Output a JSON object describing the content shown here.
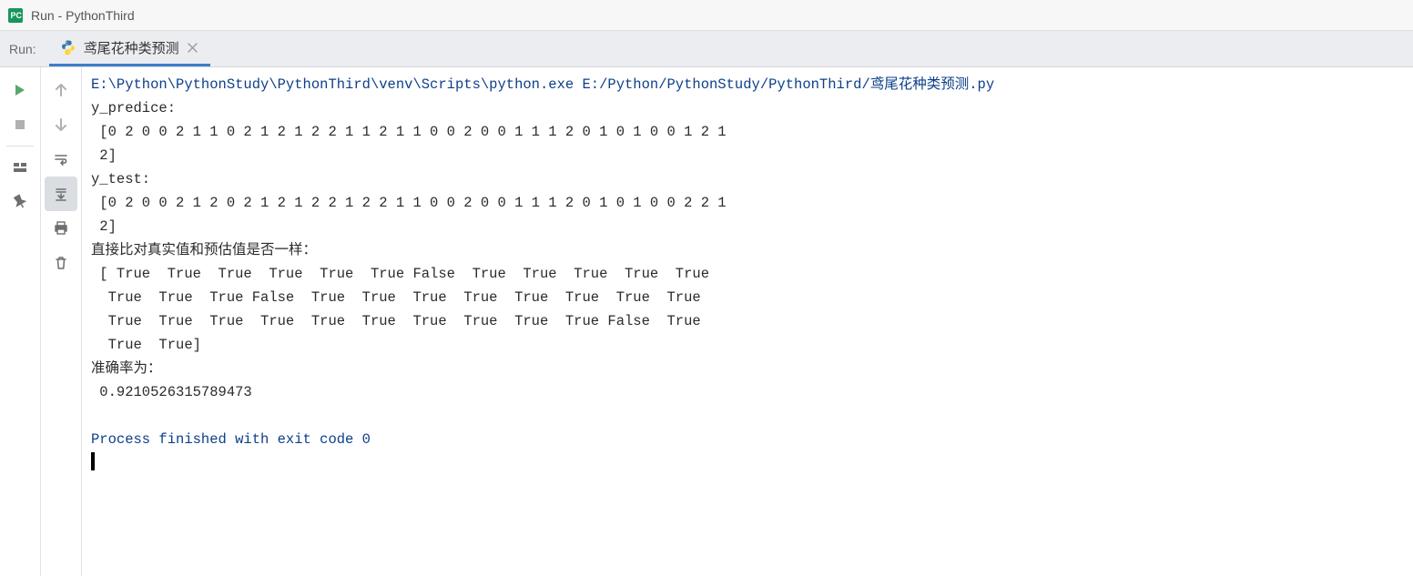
{
  "window": {
    "title": "Run - PythonThird"
  },
  "run_panel": {
    "label": "Run:",
    "tab": {
      "label": "鸢尾花种类预测"
    }
  },
  "console": {
    "command": "E:\\Python\\PythonStudy\\PythonThird\\venv\\Scripts\\python.exe E:/Python/PythonStudy/PythonThird/鸢尾花种类预测.py",
    "lines": [
      "y_predice:",
      " [0 2 0 0 2 1 1 0 2 1 2 1 2 2 1 1 2 1 1 0 0 2 0 0 1 1 1 2 0 1 0 1 0 0 1 2 1",
      " 2]",
      "y_test:",
      " [0 2 0 0 2 1 2 0 2 1 2 1 2 2 1 2 2 1 1 0 0 2 0 0 1 1 1 2 0 1 0 1 0 0 2 2 1",
      " 2]",
      "直接比对真实值和预估值是否一样：",
      " [ True  True  True  True  True  True False  True  True  True  True  True",
      "  True  True  True False  True  True  True  True  True  True  True  True",
      "  True  True  True  True  True  True  True  True  True  True False  True",
      "  True  True]",
      "准确率为：",
      " 0.9210526315789473",
      ""
    ],
    "exit_message": "Process finished with exit code 0"
  }
}
